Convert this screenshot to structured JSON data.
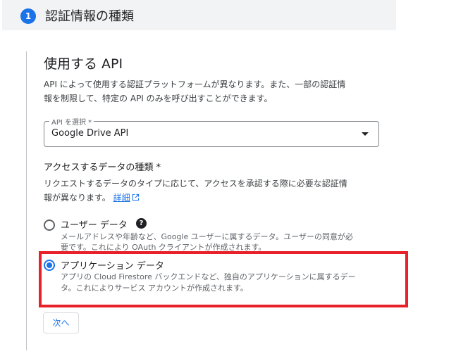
{
  "step": {
    "number": "1",
    "title": "認証情報の種類"
  },
  "api_section": {
    "title": "使用する API",
    "description_line1": "API によって使用する認証プラットフォームが異なります。また、一部の認証情",
    "description_line2": "報を制限して、特定の API のみを呼び出すことができます。",
    "select": {
      "label": "API を選択 *",
      "value": "Google Drive API"
    }
  },
  "access_section": {
    "heading": "アクセスするデータの種類 *",
    "description_line1": "リクエストするデータのタイプに応じて、アクセスを承認する際に必要な認証情",
    "description_line2": "報が異なります。",
    "details_link": "詳細",
    "options": [
      {
        "label": "ユーザー データ",
        "description_line1": "メールアドレスや年齢など、Google ユーザーに属するデータ。ユーザーの同意が必",
        "description_line2": "要です。これにより OAuth クライアントが作成されます。",
        "selected": false
      },
      {
        "label": "アプリケーション データ",
        "description_line1": "アプリの Cloud Firestore バックエンドなど、独自のアプリケーションに属するデー",
        "description_line2": "タ。これによりサービス アカウントが作成されます。",
        "selected": true
      }
    ]
  },
  "next_button": "次へ",
  "colors": {
    "accent": "#1a73e8",
    "highlight": "#e8202a"
  }
}
